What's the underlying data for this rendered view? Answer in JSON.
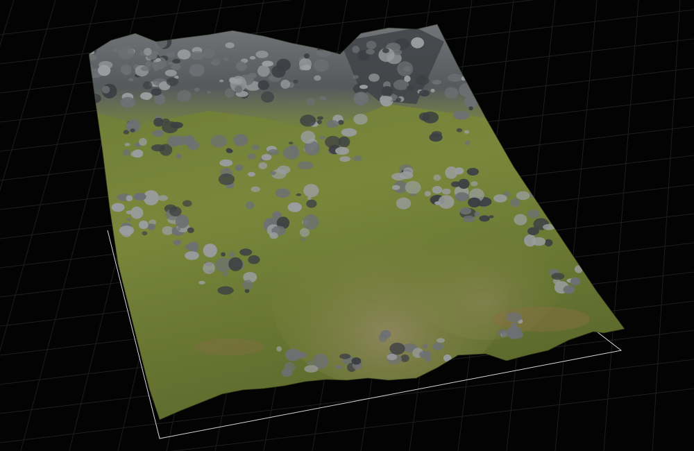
{
  "viewport": {
    "background": "#030303",
    "grid_color": "#1e1e1e",
    "bounds_color": "#d8d8d8"
  },
  "terrain": {
    "description_icon": "terrain-mesh-icon",
    "palette": {
      "grass_light": "#7d8a3e",
      "grass_mid": "#6f7b36",
      "grass_dark": "#4f5a27",
      "rock_light": "#9a9c9e",
      "rock_mid": "#6d7073",
      "rock_dark": "#3c3f43",
      "dirt": "#8a6e45"
    }
  }
}
